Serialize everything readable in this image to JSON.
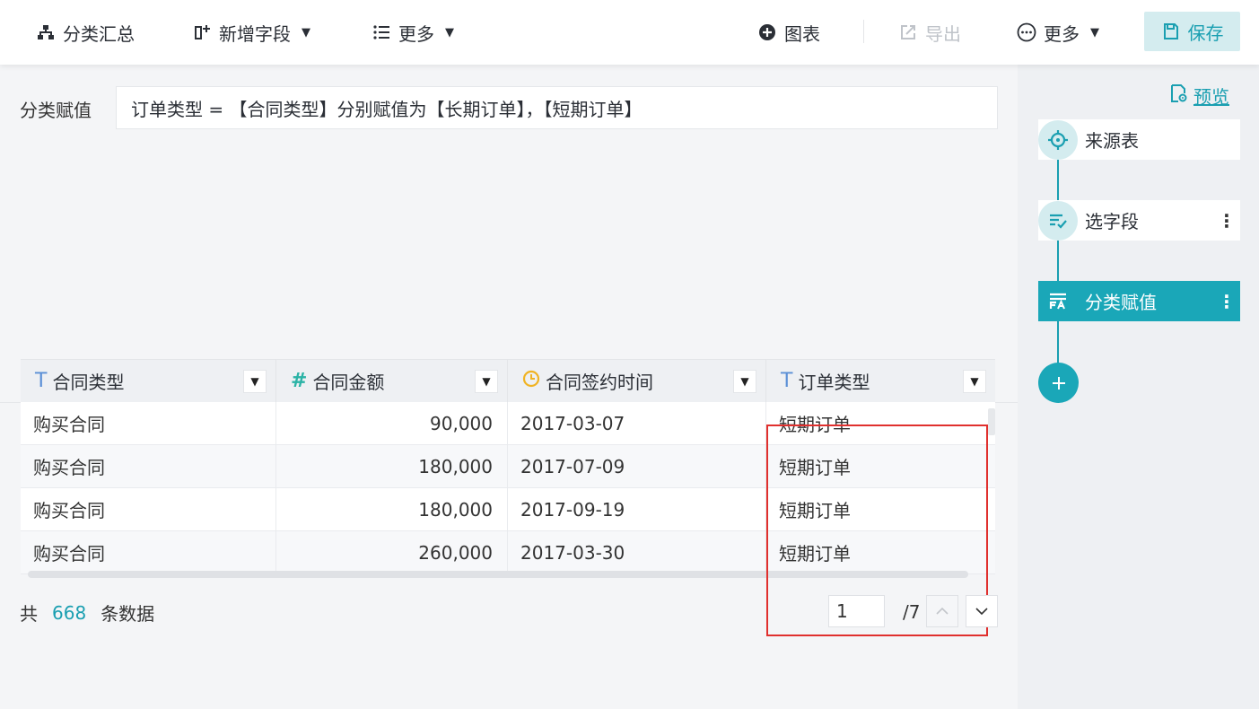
{
  "toolbar": {
    "group_summary": "分类汇总",
    "add_field": "新增字段",
    "more_left": "更多",
    "chart": "图表",
    "export": "导出",
    "more_right": "更多",
    "save": "保存"
  },
  "formula": {
    "label": "分类赋值",
    "text": "订单类型 = 【合同类型】分别赋值为【长期订单】，【短期订单】"
  },
  "table": {
    "columns": [
      {
        "label": "合同类型",
        "type_icon": "text-type-icon"
      },
      {
        "label": "合同金额",
        "type_icon": "number-type-icon"
      },
      {
        "label": "合同签约时间",
        "type_icon": "date-type-icon"
      },
      {
        "label": "订单类型",
        "type_icon": "text-type-icon"
      }
    ],
    "rows": [
      [
        "购买合同",
        "90,000",
        "2017-03-07",
        "短期订单"
      ],
      [
        "购买合同",
        "180,000",
        "2017-07-09",
        "短期订单"
      ],
      [
        "购买合同",
        "180,000",
        "2017-09-19",
        "短期订单"
      ],
      [
        "购买合同",
        "260,000",
        "2017-03-30",
        "短期订单"
      ]
    ]
  },
  "footer": {
    "prefix": "共",
    "count": "668",
    "suffix": "条数据",
    "page": "1",
    "total_pages": "/7"
  },
  "sidebar": {
    "preview": "预览",
    "steps": [
      {
        "label": "来源表"
      },
      {
        "label": "选字段"
      },
      {
        "label": "分类赋值"
      }
    ]
  },
  "colors": {
    "accent": "#1aa7b8",
    "highlight": "#e0302e"
  }
}
